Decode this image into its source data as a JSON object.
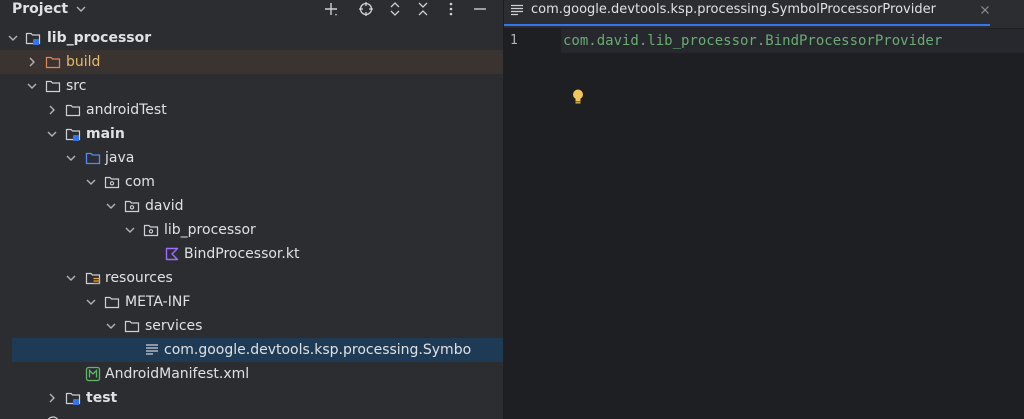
{
  "project_panel": {
    "title": "Project",
    "tools": [
      "add-icon",
      "locate-icon",
      "expand-all-icon",
      "collapse-all-icon",
      "more-icon",
      "hide-icon"
    ]
  },
  "tree": {
    "items": [
      {
        "label": "lib_processor",
        "expanded": true,
        "icon": "module-folder-icon"
      },
      {
        "label": "build",
        "expanded": false,
        "icon": "folder-icon"
      },
      {
        "label": "src",
        "expanded": true,
        "icon": "folder-icon"
      },
      {
        "label": "androidTest",
        "expanded": false,
        "icon": "folder-icon"
      },
      {
        "label": "main",
        "expanded": true,
        "icon": "source-folder-icon"
      },
      {
        "label": "java",
        "expanded": true,
        "icon": "source-root-folder-icon"
      },
      {
        "label": "com",
        "expanded": true,
        "icon": "package-icon"
      },
      {
        "label": "david",
        "expanded": true,
        "icon": "package-icon"
      },
      {
        "label": "lib_processor",
        "expanded": true,
        "icon": "package-icon"
      },
      {
        "label": "BindProcessor.kt",
        "icon": "kotlin-file-icon"
      },
      {
        "label": "resources",
        "expanded": true,
        "icon": "resources-folder-icon"
      },
      {
        "label": "META-INF",
        "expanded": true,
        "icon": "folder-icon"
      },
      {
        "label": "services",
        "expanded": true,
        "icon": "folder-icon"
      },
      {
        "label": "com.google.devtools.ksp.processing.Symbo",
        "icon": "text-file-icon",
        "selected": true
      },
      {
        "label": "AndroidManifest.xml",
        "icon": "manifest-file-icon"
      },
      {
        "label": "test",
        "expanded": false,
        "icon": "source-folder-icon"
      }
    ]
  },
  "editor": {
    "tab_label": "com.google.devtools.ksp.processing.SymbolProcessorProvider",
    "line_number": "1",
    "code": "com.david.lib_processor.BindProcessorProvider"
  },
  "colors": {
    "panel_bg": "#2b2d30",
    "editor_bg": "#1e1f22",
    "selection": "#1f3a55",
    "accent": "#3574f0",
    "string_green": "#6aab73"
  }
}
